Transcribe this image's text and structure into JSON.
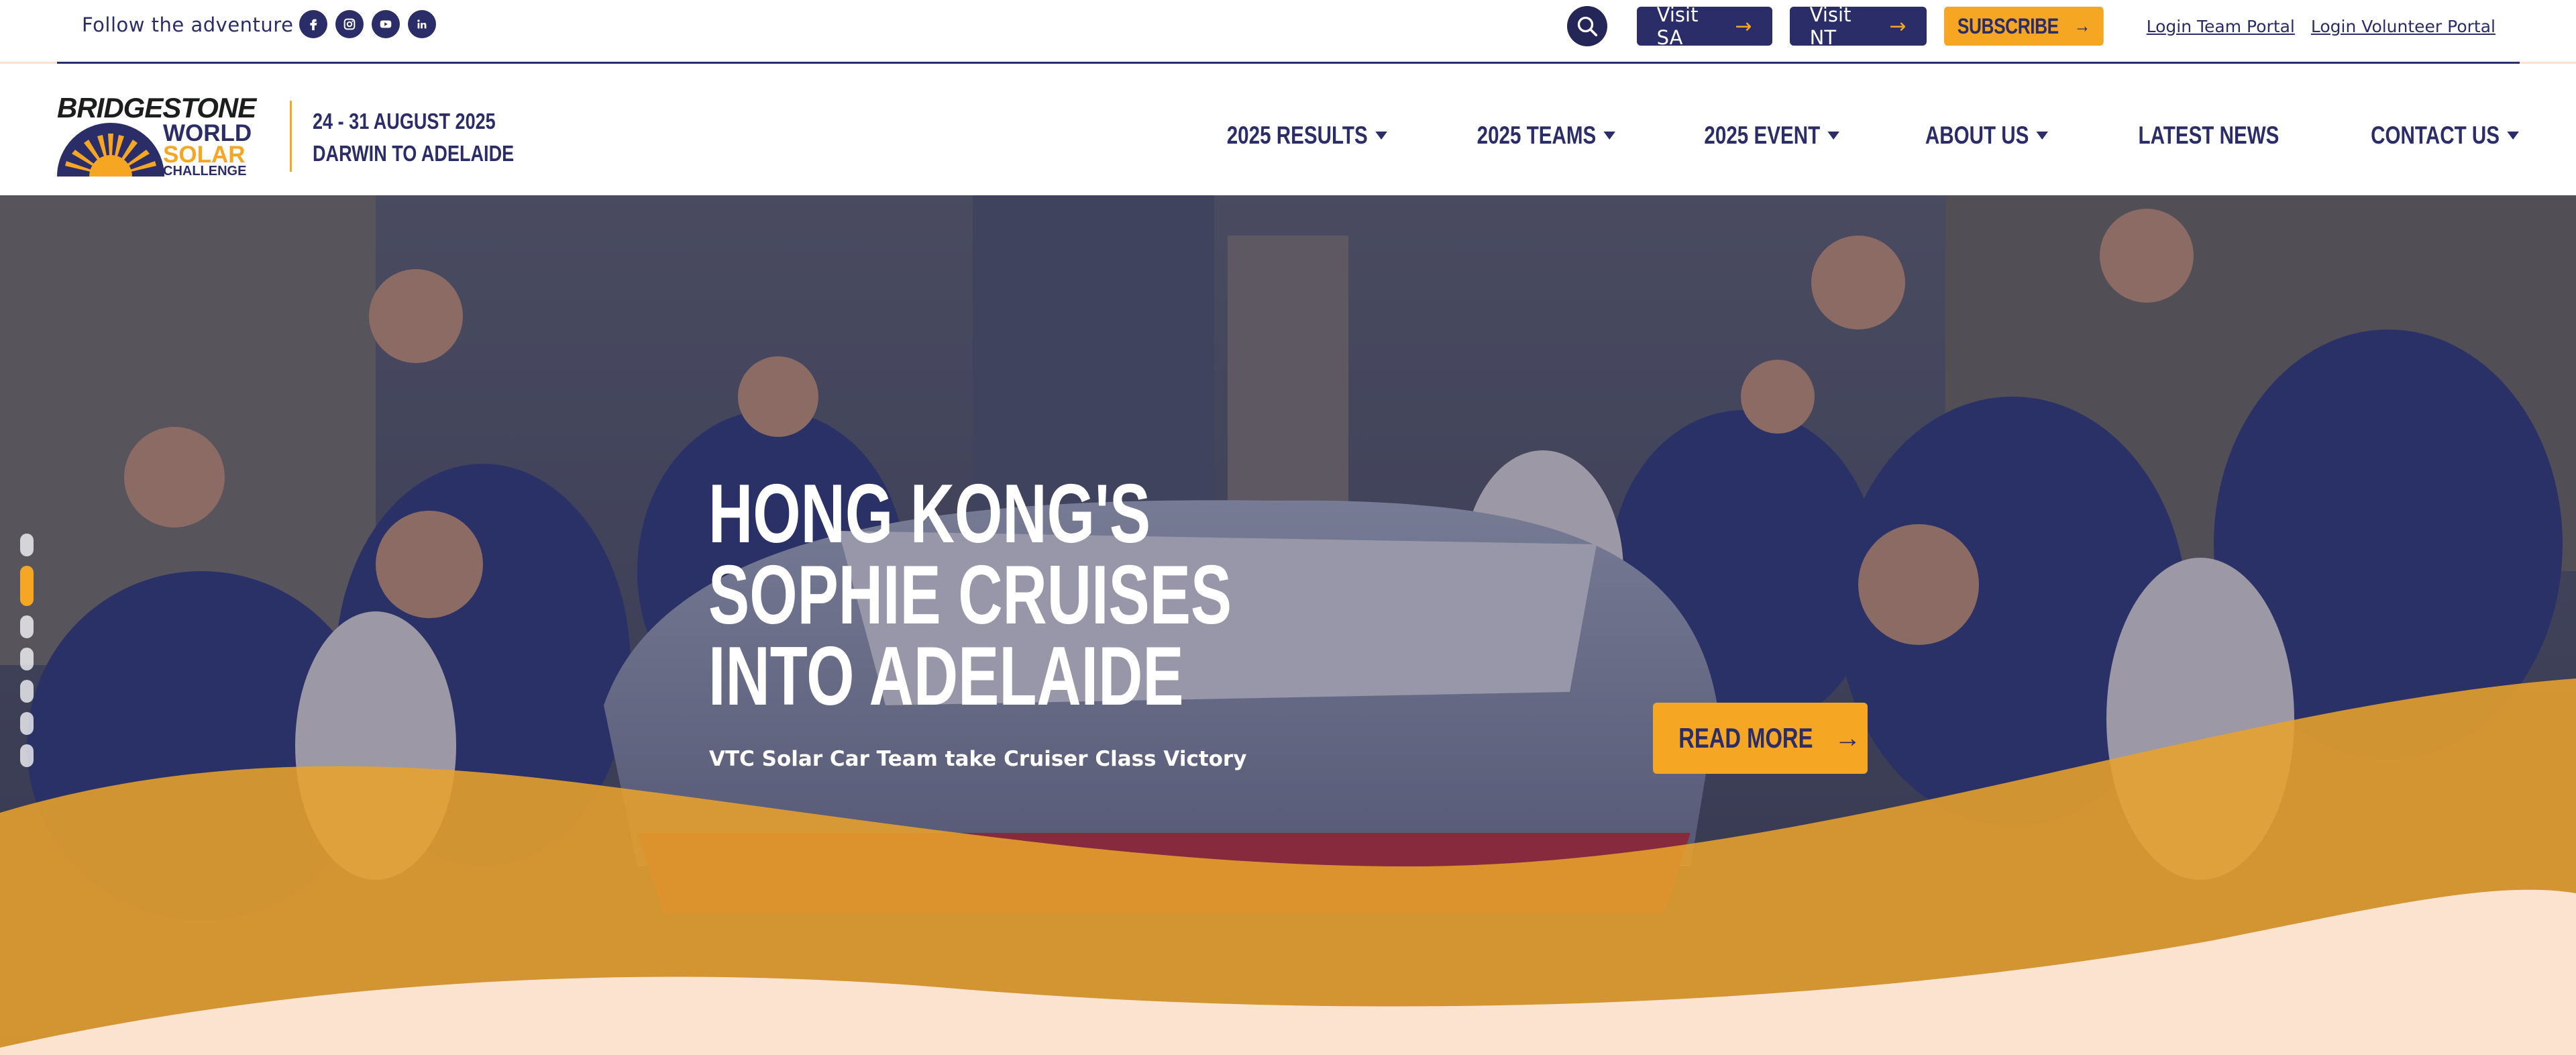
{
  "topbar": {
    "follow_label": "Follow the adventure",
    "socials": [
      "facebook-icon",
      "instagram-icon",
      "youtube-icon",
      "linkedin-icon"
    ],
    "visit_sa": "Visit SA",
    "visit_nt": "Visit NT",
    "subscribe": "SUBSCRIBE",
    "login_team": "Login Team Portal",
    "login_volunteer": "Login Volunteer Portal"
  },
  "header": {
    "logo": {
      "brand": "BRIDGESTONE",
      "line1": "WORLD",
      "line2": "SOLAR",
      "line3": "CHALLENGE"
    },
    "event_dates": "24 - 31 AUGUST 2025",
    "event_route": "DARWIN TO ADELAIDE",
    "nav": [
      {
        "label": "2025 RESULTS",
        "has_dropdown": true
      },
      {
        "label": "2025 TEAMS",
        "has_dropdown": true
      },
      {
        "label": "2025 EVENT",
        "has_dropdown": true
      },
      {
        "label": "ABOUT US",
        "has_dropdown": true
      },
      {
        "label": "LATEST NEWS",
        "has_dropdown": false
      },
      {
        "label": "CONTACT US",
        "has_dropdown": true
      }
    ]
  },
  "hero": {
    "headline_line1": "HONG KONG'S",
    "headline_line2": "SOPHIE CRUISES",
    "headline_line3": "INTO ADELAIDE",
    "subline": "VTC Solar Car Team take Cruiser Class Victory",
    "cta": "READ MORE",
    "slide_count": 7,
    "active_slide": 2
  },
  "colors": {
    "navy": "#2b2d68",
    "accent": "#f5a623",
    "cream": "#fbe3cf"
  }
}
